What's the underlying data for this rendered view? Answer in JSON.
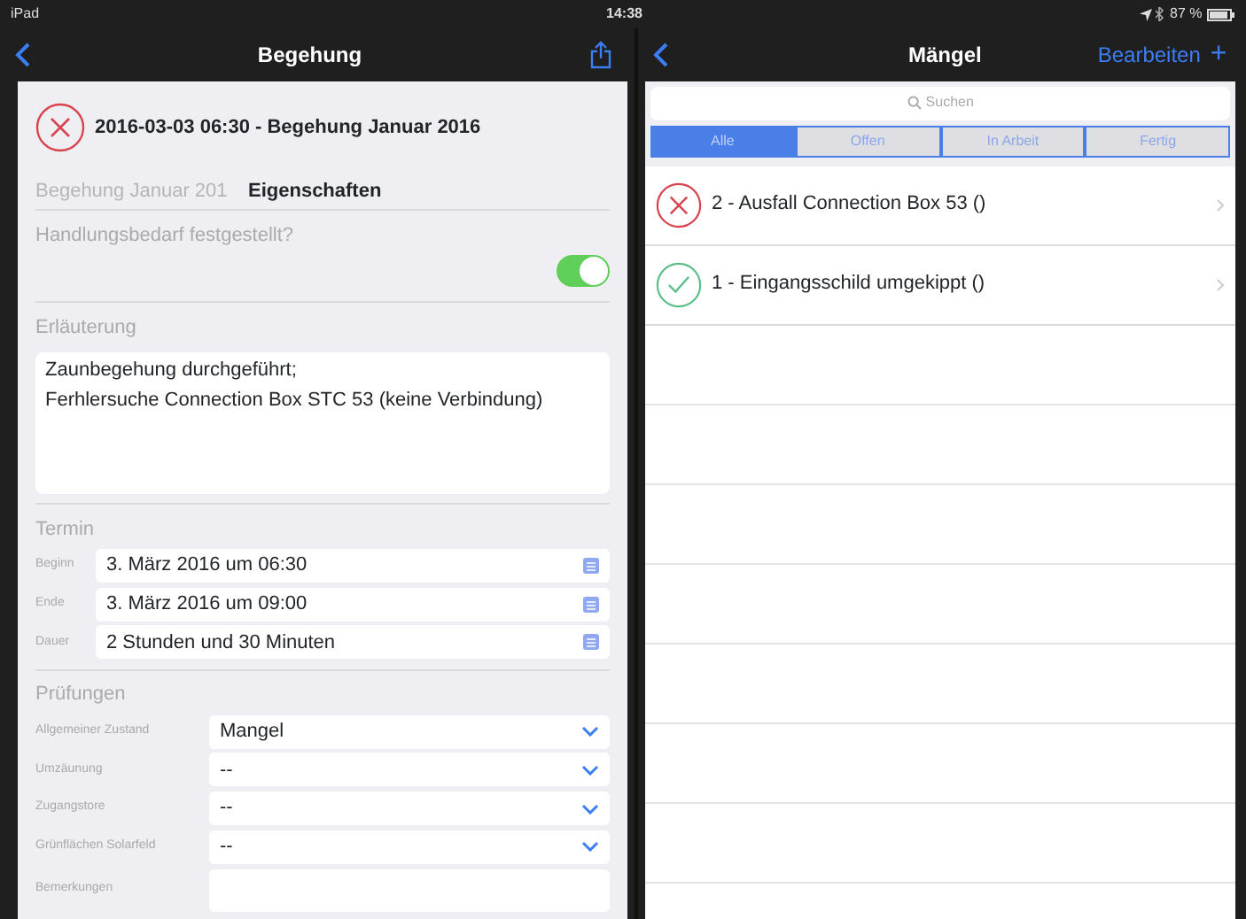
{
  "status_bar": {
    "device": "iPad",
    "time": "14:38",
    "battery": "87 %"
  },
  "left_nav": {
    "title": "Begehung"
  },
  "inspection": {
    "done": false,
    "title": "2016-03-03 06:30 - Begehung Januar 2016",
    "faded_name": "Begehung Januar 201",
    "section_title": "Eigenschaften"
  },
  "action_needed": {
    "label": "Handlungsbedarf festgestellt?",
    "on": true
  },
  "explanation": {
    "label": "Erläuterung",
    "lines": [
      "Zaunbegehung durchgeführt;",
      "Ferhlersuche Connection Box STC 53 (keine Verbindung)"
    ]
  },
  "schedule": {
    "label": "Termin",
    "fields": [
      {
        "label": "Beginn",
        "value": "3. März 2016 um 06:30"
      },
      {
        "label": "Ende",
        "value": "3. März 2016 um 09:00"
      },
      {
        "label": "Dauer",
        "value": "2 Stunden und 30 Minuten"
      }
    ]
  },
  "checks": {
    "label": "Prüfungen",
    "fields": [
      {
        "label": "Allgemeiner Zustand",
        "value": "Mangel",
        "kind": "select"
      },
      {
        "label": "Umzäunung",
        "value": "--",
        "kind": "select"
      },
      {
        "label": "Zugangstore",
        "value": "--",
        "kind": "select"
      },
      {
        "label": "Grünflächen Solarfeld",
        "value": "--",
        "kind": "select"
      },
      {
        "label": "Bemerkungen",
        "kind": "text"
      }
    ]
  },
  "right_nav": {
    "title": "Mängel",
    "edit": "Bearbeiten",
    "add": "+"
  },
  "search": {
    "placeholder": "Suchen"
  },
  "filters": [
    {
      "label": "Alle",
      "selected": true
    },
    {
      "label": "Offen",
      "selected": false
    },
    {
      "label": "In Arbeit",
      "selected": false
    },
    {
      "label": "Fertig",
      "selected": false
    }
  ],
  "defects": [
    {
      "title": "2 - Ausfall Connection Box 53 ()",
      "done": false
    },
    {
      "title": "1 - Eingangsschild umgekippt ()",
      "done": true
    }
  ]
}
